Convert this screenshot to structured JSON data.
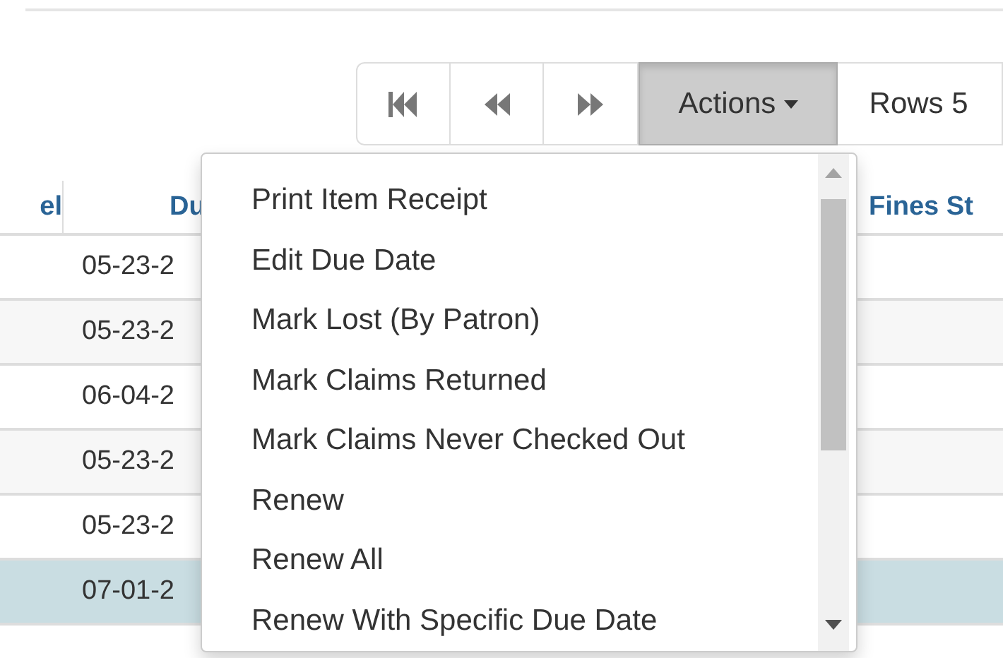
{
  "toolbar": {
    "buttons": [
      {
        "kind": "first",
        "pressed": false
      },
      {
        "kind": "previous",
        "pressed": false
      },
      {
        "kind": "next",
        "pressed": false
      }
    ],
    "actions": {
      "label": "Actions",
      "pressed": true
    },
    "rows": {
      "label": "Rows 5"
    }
  },
  "table": {
    "columns": [
      "el",
      "Du",
      "Fines St"
    ],
    "rows": [
      {
        "cells": [
          "",
          "05-23-2",
          ""
        ],
        "selected": false
      },
      {
        "cells": [
          "",
          "05-23-2",
          ""
        ],
        "selected": false
      },
      {
        "cells": [
          "",
          "06-04-2",
          ""
        ],
        "selected": false
      },
      {
        "cells": [
          "",
          "05-23-2",
          ""
        ],
        "selected": false
      },
      {
        "cells": [
          "",
          "05-23-2",
          ""
        ],
        "selected": false
      },
      {
        "cells": [
          "",
          "07-01-2",
          ""
        ],
        "selected": true
      }
    ]
  },
  "actions_menu": {
    "items": [
      "Print Item Receipt",
      "Edit Due Date",
      "Mark Lost (By Patron)",
      "Mark Claims Returned",
      "Mark Claims Never Checked Out",
      "Renew",
      "Renew All",
      "Renew With Specific Due Date"
    ]
  }
}
